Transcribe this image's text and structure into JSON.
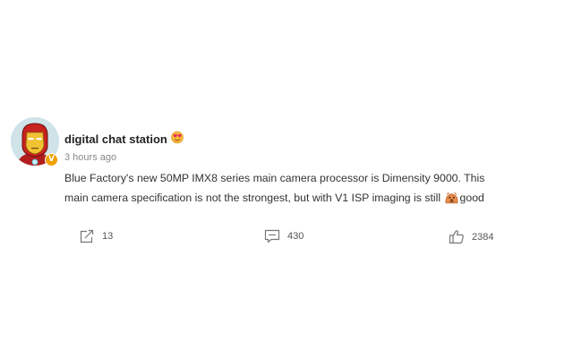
{
  "post": {
    "author": {
      "name": "digital chat station",
      "avatar_icon": "iron-man-avatar-icon",
      "badge_label": "V",
      "badge_color": "#f0a000",
      "name_emoji_icon": "heart-eyes-emoji-icon"
    },
    "timestamp": "3 hours ago",
    "text_line1": "Blue Factory's new 50MP IMX8 series main camera processor is Dimensity 9000. This",
    "text_line2_part1": "main camera specification is not the strongest, but with V1 ISP imaging is still ",
    "inline_emoji_icon": "doge-emoji-icon",
    "text_line2_part2": "good",
    "actions": {
      "share": {
        "icon": "share-icon",
        "count": "13"
      },
      "comment": {
        "icon": "comment-icon",
        "count": "430"
      },
      "like": {
        "icon": "thumbs-up-icon",
        "count": "2384"
      }
    }
  }
}
